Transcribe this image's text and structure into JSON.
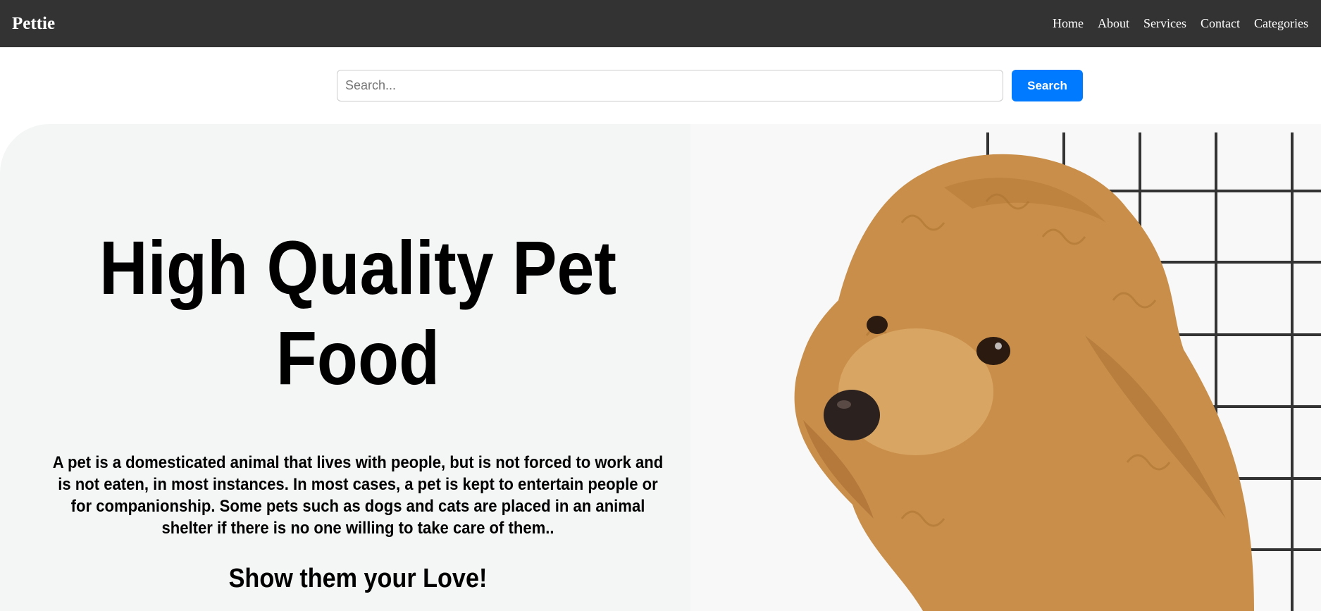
{
  "navbar": {
    "brand": "Pettie",
    "links": [
      "Home",
      "About",
      "Services",
      "Contact",
      "Categories"
    ]
  },
  "search": {
    "placeholder": "Search...",
    "value": "",
    "button_label": "Search"
  },
  "hero": {
    "title": "High Quality Pet Food",
    "description": "A pet is a domesticated animal that lives with people, but is not forced to work and is not eaten, in most instances. In most cases, a pet is kept to entertain people or for companionship. Some pets such as dogs and cats are placed in an animal shelter if there is no one willing to take care of them..",
    "tagline": "Show them your Love!",
    "image_subject": "poodle-dog"
  },
  "colors": {
    "navbar_bg": "#333333",
    "accent": "#007bff",
    "hero_bg": "#f4f5f5",
    "dog_fur": "#c98f4a"
  }
}
